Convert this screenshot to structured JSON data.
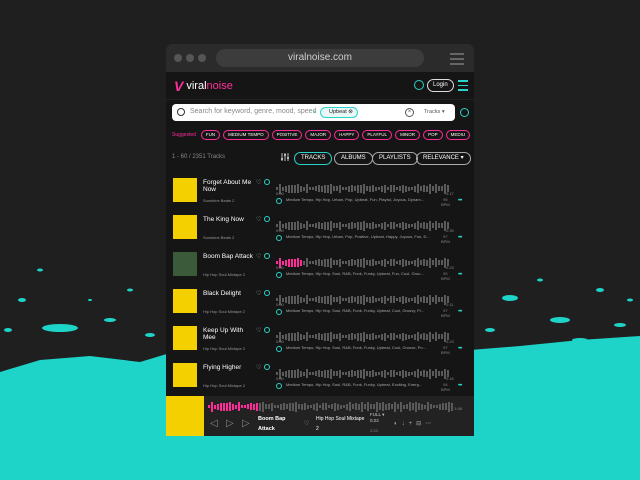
{
  "window": {
    "url": "viralnoise.com"
  },
  "nav": {
    "brand_left": "viral",
    "brand_right": "noise",
    "login_label": "Login"
  },
  "search": {
    "placeholder": "Search for keyword, genre, mood, speed",
    "tag": "Upbeat",
    "type_select": "Tracks"
  },
  "suggested": {
    "label": "Suggested",
    "chips": [
      "FUN",
      "MEDIUM TEMPO",
      "POSITIVE",
      "MAJOR",
      "HAPPY",
      "PLAYFUL",
      "MINOR",
      "POP",
      "MEDIU"
    ]
  },
  "results": {
    "count": "1 - 60 / 2351 Tracks",
    "tabs": [
      "TRACKS",
      "ALBUMS",
      "PLAYLISTS"
    ],
    "sort": "RELEVANCE"
  },
  "tracks": [
    {
      "title": "Forget About Me Now",
      "artist": "Sunshine Beats 2",
      "time": "0:00",
      "duration": "3:17",
      "bpm": "95",
      "bpm_unit": "BPM",
      "desc": "Medium Tempo, Hip Hop, Urban, Pop, Upbeat, Fun, Playful, Joyous, Dynam...",
      "progress": 0
    },
    {
      "title": "The King Now",
      "artist": "Sunshine Beats 2",
      "time": "0:00",
      "duration": "2:39",
      "bpm": "97",
      "bpm_unit": "BPM",
      "desc": "Medium Tempo, Hip Hop, Urban, Pop, Positive, Upbeat, Happy, Joyous, Fun, D...",
      "progress": 0
    },
    {
      "title": "Boom Bap Attack",
      "artist": "Hip Hop Soul Mixtape 2",
      "time": "0:00",
      "duration": "2:23",
      "bpm": "90",
      "bpm_unit": "BPM",
      "desc": "Medium Tempo, Hip Hop, Soul, R&B, Funk, Funky, Upbeat, Fun, Cool, Groo...",
      "progress": 0.14
    },
    {
      "title": "Black Delight",
      "artist": "Hip Hop Soul Mixtape 2",
      "time": "0:00",
      "duration": "2:11",
      "bpm": "97",
      "bpm_unit": "BPM",
      "desc": "Medium Tempo, Hip Hop, Soul, R&B, Funk, Funky, Upbeat, Cool, Groovy, Pl...",
      "progress": 0
    },
    {
      "title": "Keep Up With Mee",
      "artist": "Hip Hop Soul Mixtape 2",
      "time": "0:00",
      "duration": "2:23",
      "bpm": "97",
      "bpm_unit": "BPM",
      "desc": "Medium Tempo, Hip Hop, Soul, R&B, Funk, Funky, Upbeat, Cool, Groove, Po...",
      "progress": 0
    },
    {
      "title": "Flying Higher",
      "artist": "Hip Hop Soul Mixtape 2",
      "time": "0:00",
      "duration": "2:16",
      "bpm": "94",
      "bpm_unit": "BPM",
      "desc": "Medium Tempo, Hip Hop, Soul, R&B, Funk, Funky, Upbeat, Exciting, Energ...",
      "progress": 0
    }
  ],
  "player": {
    "title": "Boom Bap Attack",
    "artist": "Hip Hop Soul Mixtape 2",
    "full_label": "FULL",
    "time": "0:22",
    "full_time": "2:23",
    "duration": "1:58",
    "progress": 0.2
  },
  "colors": {
    "accent": "#29d3c9",
    "brand": "#ff2d9a",
    "splash": "#1ed3c8"
  }
}
